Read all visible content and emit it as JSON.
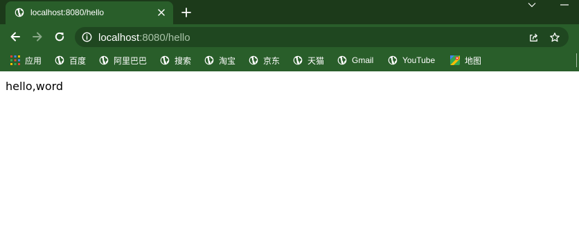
{
  "tab": {
    "title": "localhost:8080/hello",
    "favicon": "globe-icon"
  },
  "toolbar": {
    "url_host": "localhost",
    "url_path": ":8080/hello"
  },
  "bookmarks": [
    {
      "label": "应用",
      "icon": "apps-grid-icon"
    },
    {
      "label": "百度",
      "icon": "globe-icon"
    },
    {
      "label": "阿里巴巴",
      "icon": "globe-icon"
    },
    {
      "label": "搜索",
      "icon": "globe-icon"
    },
    {
      "label": "淘宝",
      "icon": "globe-icon"
    },
    {
      "label": "京东",
      "icon": "globe-icon"
    },
    {
      "label": "天猫",
      "icon": "globe-icon"
    },
    {
      "label": "Gmail",
      "icon": "globe-icon"
    },
    {
      "label": "YouTube",
      "icon": "globe-icon"
    },
    {
      "label": "地图",
      "icon": "maps-icon"
    }
  ],
  "page": {
    "body_text": "hello,word"
  },
  "colors": {
    "tabstrip_bg": "#1c3a1a",
    "toolbar_bg": "#295e2a",
    "omnibox_bg": "#1f4720",
    "text_light": "#ffffff",
    "url_path": "#a9c3a8"
  }
}
